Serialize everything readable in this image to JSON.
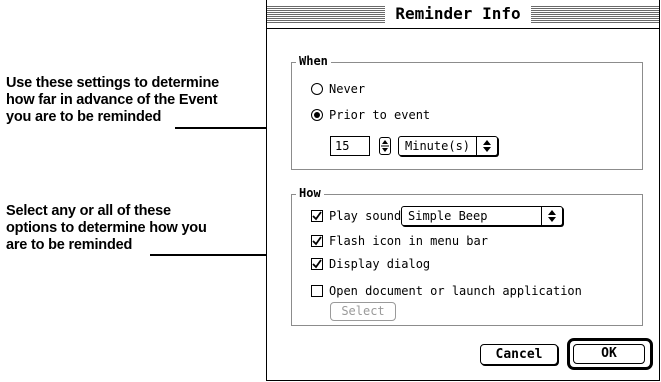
{
  "callouts": {
    "when": [
      "Use these settings to determine",
      "how far in advance of the Event",
      "you are to be reminded"
    ],
    "how": [
      "Select any or all of these",
      "options to determine how you",
      "are to be reminded"
    ]
  },
  "window": {
    "title": "Reminder Info"
  },
  "when_group": {
    "label": "When",
    "never_label": "Never",
    "prior_label": "Prior to event",
    "selected": "Prior to event",
    "amount_value": "15",
    "unit_value": "Minute(s)"
  },
  "how_group": {
    "label": "How",
    "play_sound_label": "Play sound",
    "play_sound_checked": true,
    "sound_value": "Simple Beep",
    "flash_label": "Flash icon in menu bar",
    "flash_checked": true,
    "dialog_label": "Display dialog",
    "dialog_checked": true,
    "open_label": "Open document or launch application",
    "open_checked": false,
    "select_button": "Select"
  },
  "buttons": {
    "cancel": "Cancel",
    "ok": "OK"
  }
}
